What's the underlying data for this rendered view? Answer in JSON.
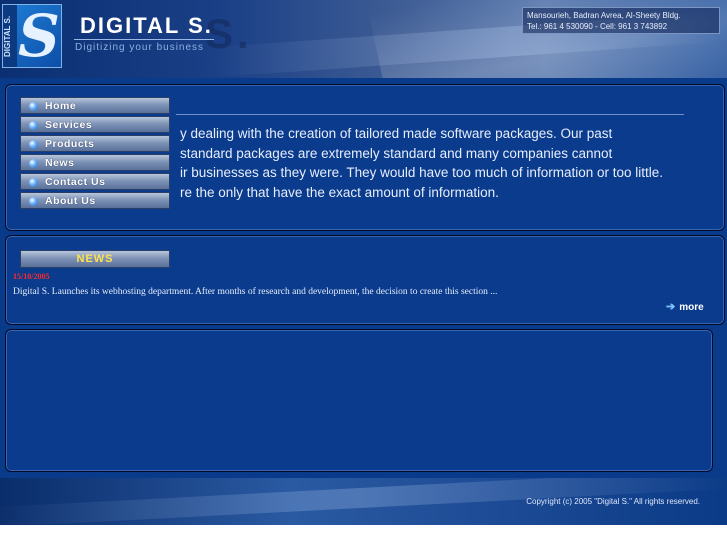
{
  "header": {
    "logo_side_text": "DIGITAL S.",
    "logo_letter": "S",
    "brand": "DIGITAL S.",
    "ghost_text": "S.",
    "tagline": "Digitizing your business",
    "address_line1": "Mansourieh, Badran Avrea, Al-Sheety Bldg.",
    "address_line2": "Tel.: 961 4 530090 - Cell: 961 3 743892"
  },
  "nav": {
    "items": [
      {
        "label": "Home"
      },
      {
        "label": "Services"
      },
      {
        "label": "Products"
      },
      {
        "label": "News"
      },
      {
        "label": "Contact Us"
      },
      {
        "label": "About Us"
      }
    ]
  },
  "intro": {
    "lines": [
      "y dealing with the creation of tailored made software packages. Our past",
      "standard packages are extremely standard and many companies cannot",
      "ir businesses as they were. They would have too much of information or too little.",
      "re the only that have the exact amount of information."
    ]
  },
  "news": {
    "title": "NEWS",
    "date": "15/10/2005",
    "text": "Digital S. Launches its webhosting department. After months of research and development, the decision to create this section ...",
    "more_label": "more"
  },
  "footer": {
    "copyright": "Copyright (c) 2005 \"Digital S.\" All rights reserved."
  },
  "colors": {
    "background": "#0a3a8a",
    "news_title": "#ffe34d",
    "news_date": "#ff2a2a",
    "text": "#e6eefc"
  }
}
